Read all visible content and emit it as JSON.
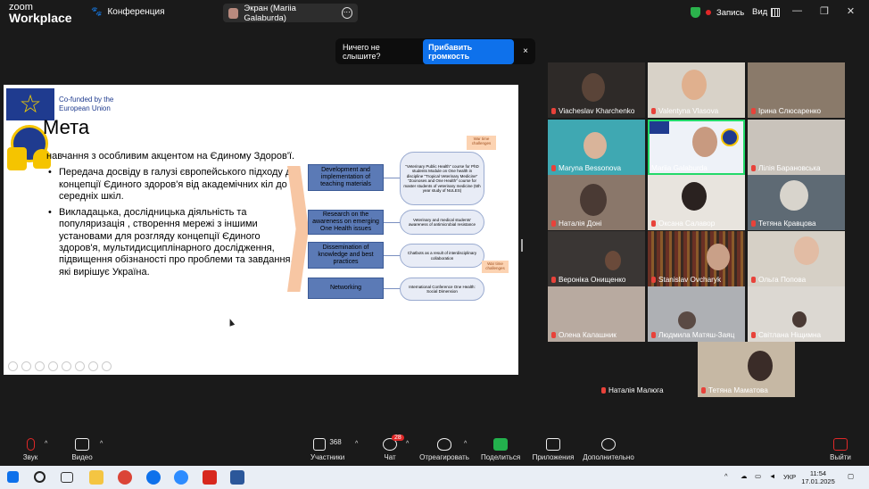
{
  "app": {
    "logo_line1": "zoom",
    "logo_line2": "Workplace",
    "conference_label": "Конференция",
    "screen_share_label": "Экран (Mariia Galaburda)",
    "record_label": "Запись",
    "view_label": "Вид"
  },
  "notice": {
    "text": "Ничего не слышите?",
    "button": "Прибавить громкость",
    "close": "×"
  },
  "slide": {
    "eu_text": "Co-funded by the European Union",
    "title": "Мета",
    "paragraph1": "навчання з особливим акцентом на Єдиному Здоров'ї.",
    "bullet1": "Передача досвіду в галузі європейського підходу до концепції Єдиного здоров'я від академічних кіл до середніх шкіл.",
    "bullet2": "Викладацька, дослідницька діяльність та популяризація , створення мережі з іншими установами для розгляду концепції Єдиного здоров'я, мультидисциплінарного дослідження, підвищення обізнаності про проблеми та завдання, які вирішує Україна.",
    "boxes": [
      "Development and implementation of teaching materials",
      "Research on the awareness on emerging One Health issues",
      "Dissemination of knowledge and best practices",
      "Networking"
    ],
    "pills": [
      "\"Veterinary Public Health\" course for PhD students  Module on One health in discipline \"Tropical Veterinary Medicine\"  \"Zoonoses and One Health\" course for master students of veterinary medicine (5th year study of NULES)",
      "Veterinary and medical students' awareness of antimicrobial resistance",
      "Chatbots as a result of interdisciplinary collaboration",
      "International Conference One Health: Social Dimension"
    ],
    "tags": [
      "War time challenges",
      "War time challenges"
    ]
  },
  "participants": [
    {
      "name": "Viacheslav Kharchenko",
      "muted": true
    },
    {
      "name": "Valentyna Vlasova",
      "muted": true
    },
    {
      "name": "Ірина Слюсаренко",
      "muted": true
    },
    {
      "name": "Maryna Bessonova",
      "muted": true
    },
    {
      "name": "Mariia Galaburda",
      "muted": false
    },
    {
      "name": "Лілія Барановська",
      "muted": true
    },
    {
      "name": "Наталія Доні",
      "muted": true
    },
    {
      "name": "Оксана Салавор",
      "muted": true
    },
    {
      "name": "Тетяна Кравцова",
      "muted": true
    },
    {
      "name": "Вероніка Онищенко",
      "muted": true
    },
    {
      "name": "Stanislav Ovcharyk",
      "muted": true
    },
    {
      "name": "Ольга Попова",
      "muted": true
    },
    {
      "name": "Олена Калашник",
      "muted": true
    },
    {
      "name": "Людмила Матяш-Заяц",
      "muted": true
    },
    {
      "name": "Світлана Ніщимна",
      "muted": true
    },
    {
      "name": "Наталія Малюга",
      "muted": true
    },
    {
      "name": "Тетяна Маматова",
      "muted": true
    }
  ],
  "toolbar": {
    "audio": "Звук",
    "video": "Видео",
    "participants": "Участники",
    "participants_count": "368",
    "chat": "Чат",
    "chat_badge": "28",
    "react": "Отреагировать",
    "share": "Поделиться",
    "apps": "Приложения",
    "more": "Дополнительно",
    "leave": "Выйти"
  },
  "taskbar": {
    "lang": "УКР",
    "time": "11:54",
    "date": "17.01.2025"
  },
  "colors": {
    "accent": "#0e71eb",
    "active_speaker": "#23d96a",
    "share_green": "#23b14d",
    "leave_red": "#e02828"
  }
}
